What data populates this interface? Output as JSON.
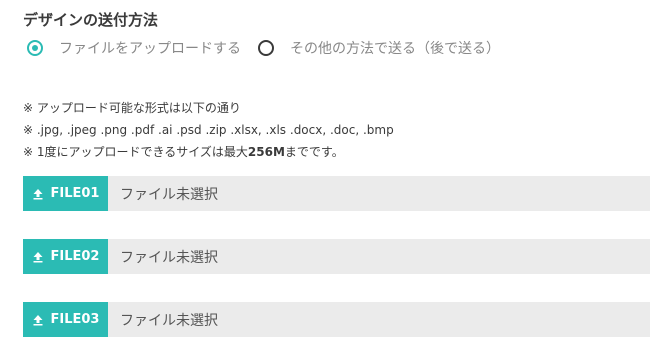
{
  "section": {
    "title": "デザインの送付方法"
  },
  "delivery_options": [
    {
      "label": "ファイルをアップロードする",
      "selected": true
    },
    {
      "label": "その他の方法で送る（後で送る）",
      "selected": false
    }
  ],
  "notes": {
    "line1": "※ アップロード可能な形式は以下の通り",
    "line2": "※ .jpg, .jpeg .png .pdf .ai .psd .zip .xlsx, .xls .docx, .doc, .bmp",
    "line3_prefix": "※ 1度にアップロードできるサイズは最大",
    "line3_limit": "256M",
    "line3_suffix": "までです。"
  },
  "files": [
    {
      "button_label": "FILE01",
      "status": "ファイル未選択"
    },
    {
      "button_label": "FILE02",
      "status": "ファイル未選択"
    },
    {
      "button_label": "FILE03",
      "status": "ファイル未選択"
    }
  ],
  "colors": {
    "accent": "#2bbbb4",
    "field_bg": "#ebebeb",
    "text": "#3a3a3a",
    "muted": "#888888"
  },
  "icons": {
    "file_button": "upload-icon"
  }
}
